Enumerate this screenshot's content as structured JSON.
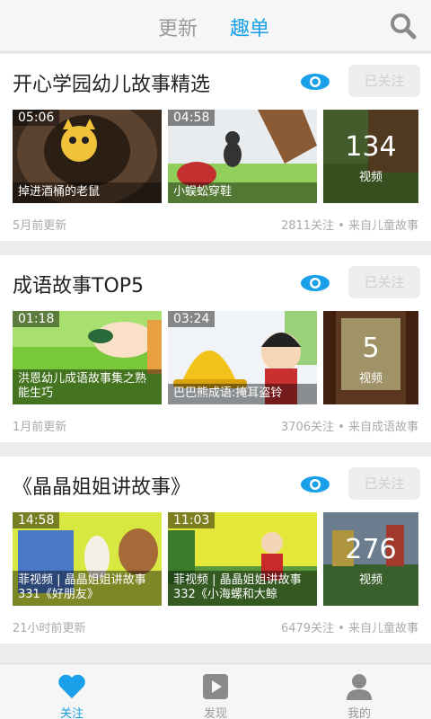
{
  "header": {
    "tabs": [
      "更新",
      "趣单"
    ]
  },
  "cards": [
    {
      "title": "开心学园幼儿故事精选",
      "follow_label": "已关注",
      "thumbs": [
        {
          "duration": "05:06",
          "caption": "掉进酒桶的老鼠"
        },
        {
          "duration": "04:58",
          "caption": "小蜈蚣穿鞋"
        },
        {
          "count": "134",
          "count_label": "视频"
        }
      ],
      "updated": "5月前更新",
      "stats": "2811关注 • 来自儿童故事"
    },
    {
      "title": "成语故事TOP5",
      "follow_label": "已关注",
      "thumbs": [
        {
          "duration": "01:18",
          "caption": "洪恩幼儿成语故事集之熟能生巧"
        },
        {
          "duration": "03:24",
          "caption": "巴巴熊成语:掩耳盗铃"
        },
        {
          "count": "5",
          "count_label": "视频"
        }
      ],
      "updated": "1月前更新",
      "stats": "3706关注 • 来自成语故事"
    },
    {
      "title": "《晶晶姐姐讲故事》",
      "follow_label": "已关注",
      "thumbs": [
        {
          "duration": "14:58",
          "caption": "菲视频 | 晶晶姐姐讲故事 331《好朋友》"
        },
        {
          "duration": "11:03",
          "caption": "菲视频 | 晶晶姐姐讲故事 332《小海螺和大鲸"
        },
        {
          "count": "276",
          "count_label": "视频"
        }
      ],
      "updated": "21小时前更新",
      "stats": "6479关注 • 来自儿童故事"
    }
  ],
  "bottom_nav": [
    {
      "label": "关注",
      "icon": "heart-icon",
      "active": true
    },
    {
      "label": "发现",
      "icon": "play-icon",
      "active": false
    },
    {
      "label": "我的",
      "icon": "person-icon",
      "active": false
    }
  ],
  "colors": {
    "accent": "#1aa0e8",
    "inactive": "#9a9a9a"
  }
}
